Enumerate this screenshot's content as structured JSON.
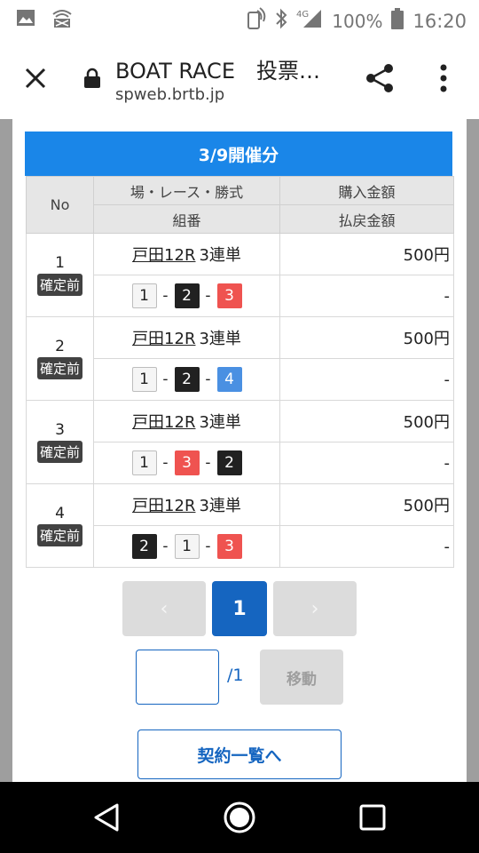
{
  "status_bar": {
    "time": "16:20",
    "battery": "100%",
    "network": "4G"
  },
  "browser": {
    "title": "BOAT RACE　投票…",
    "url": "spweb.brtb.jp"
  },
  "date_header": "3/9開催分",
  "table": {
    "headers": {
      "no": "No",
      "race": "場・レース・勝式",
      "combo": "組番",
      "purchase": "購入金額",
      "payout": "払戻金額"
    },
    "rows": [
      {
        "no": "1",
        "status": "確定前",
        "race": "戸田12R",
        "bet_type": "3連単",
        "boats": [
          "1",
          "2",
          "3"
        ],
        "purchase": "500円",
        "payout": "-"
      },
      {
        "no": "2",
        "status": "確定前",
        "race": "戸田12R",
        "bet_type": "3連単",
        "boats": [
          "1",
          "2",
          "4"
        ],
        "purchase": "500円",
        "payout": "-"
      },
      {
        "no": "3",
        "status": "確定前",
        "race": "戸田12R",
        "bet_type": "3連単",
        "boats": [
          "1",
          "3",
          "2"
        ],
        "purchase": "500円",
        "payout": "-"
      },
      {
        "no": "4",
        "status": "確定前",
        "race": "戸田12R",
        "bet_type": "3連単",
        "boats": [
          "2",
          "1",
          "3"
        ],
        "purchase": "500円",
        "payout": "-"
      }
    ]
  },
  "pagination": {
    "prev": "‹",
    "current": "1",
    "next": "›",
    "total": "/1",
    "jump_value": "",
    "jump_button": "移動"
  },
  "contracts_button": "契約一覧へ",
  "colors": {
    "header_blue": "#1a86e8",
    "accent_blue": "#1565c0",
    "boat_1": "#f5f5f5",
    "boat_2": "#212121",
    "boat_3": "#ef5350",
    "boat_4": "#4a90e2"
  }
}
